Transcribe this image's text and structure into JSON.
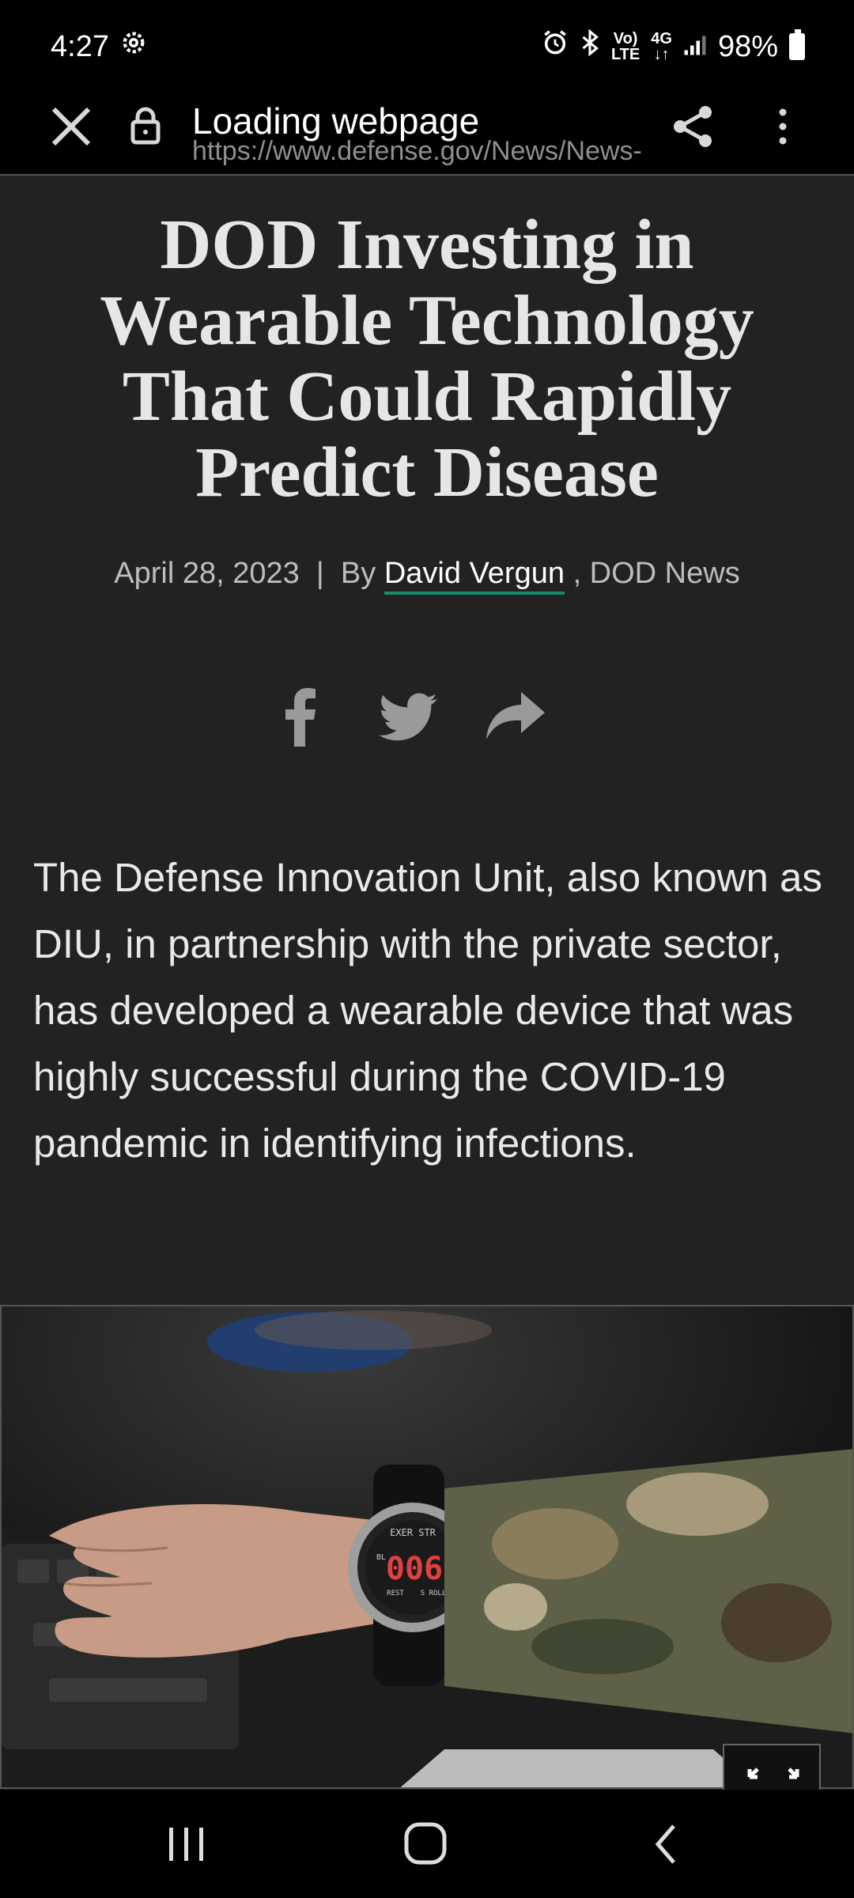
{
  "status": {
    "time": "4:27",
    "net_top": "Vo)",
    "net_bottom": "LTE",
    "gen": "4G",
    "battery": "98%"
  },
  "toolbar": {
    "title": "Loading webpage",
    "url": "https://www.defense.gov/News/News-Stories/Article/"
  },
  "article": {
    "headline": "DOD Investing in Wearable Technology That Could Rapidly Predict Disease",
    "date": "April 28, 2023",
    "separator": "|",
    "by": "By",
    "author": "David Vergun",
    "source": ", DOD News",
    "body": "The Defense Innovation Unit, also known as DIU, in partnership with the private sector, has developed a wearable device that was highly successful during the COVID-19 pandemic in identifying infections."
  },
  "watch": {
    "top_label": "EXER STR",
    "display": "006",
    "side_label": "BL",
    "bottom_left": "REST",
    "bottom_right": "S ROLL"
  },
  "colors": {
    "accent_underline": "#1a8a6c",
    "page_bg": "#222222"
  },
  "icons": [
    "settings-gear-icon",
    "alarm-icon",
    "bluetooth-icon",
    "signal-icon",
    "battery-icon",
    "close-icon",
    "lock-icon",
    "share-icon",
    "more-vert-icon",
    "facebook-icon",
    "twitter-icon",
    "share-forward-icon",
    "expand-icon",
    "recents-nav-icon",
    "home-nav-icon",
    "back-nav-icon"
  ]
}
